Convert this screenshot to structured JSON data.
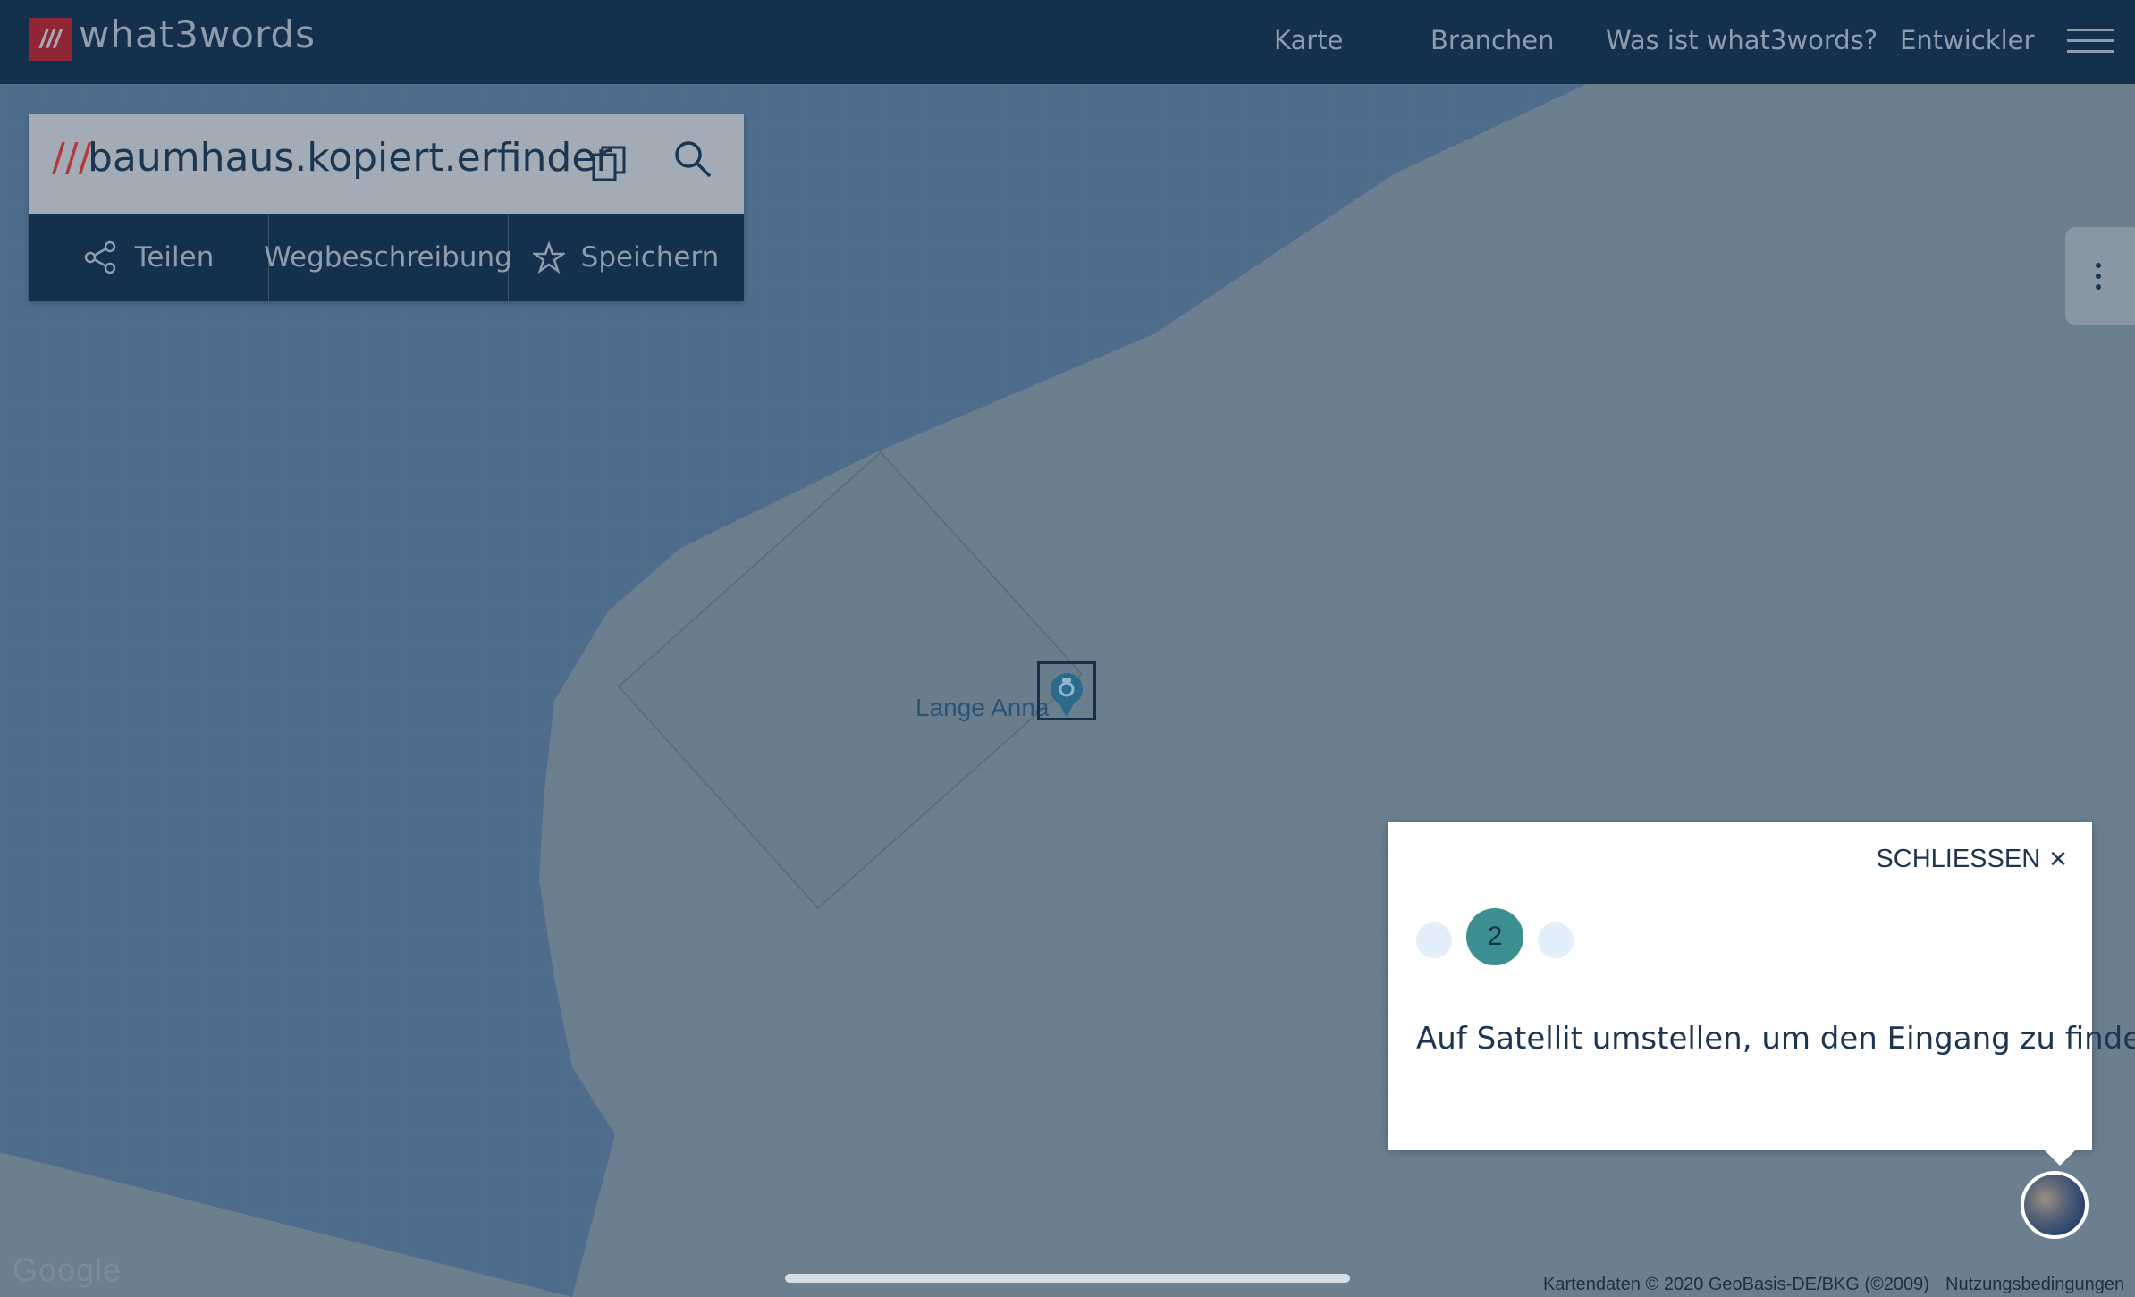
{
  "header": {
    "logo_mark": "///",
    "brand": "what3words",
    "nav": [
      "Karte",
      "Branchen",
      "Was ist what3words?",
      "Entwickler"
    ]
  },
  "search": {
    "slashes": "///",
    "address": "baumhaus.kopiert.erfinder"
  },
  "actions": {
    "share": "Teilen",
    "route": "Wegbeschreibung",
    "save": "Speichern"
  },
  "map": {
    "marker_label": "Lange Anna",
    "google": "Google",
    "attribution": "Kartendaten © 2020 GeoBasis-DE/BKG (©2009)",
    "terms": "Nutzungsbedingungen"
  },
  "tooltip": {
    "close": "SCHLIESSEN",
    "step": "2",
    "text": "Auf Satellit umstellen, um den Eingang zu finden"
  },
  "colors": {
    "header": "#15304c",
    "water": "#4e6d8c",
    "land": "#6b7f8f",
    "step_active": "#3c8f91"
  }
}
